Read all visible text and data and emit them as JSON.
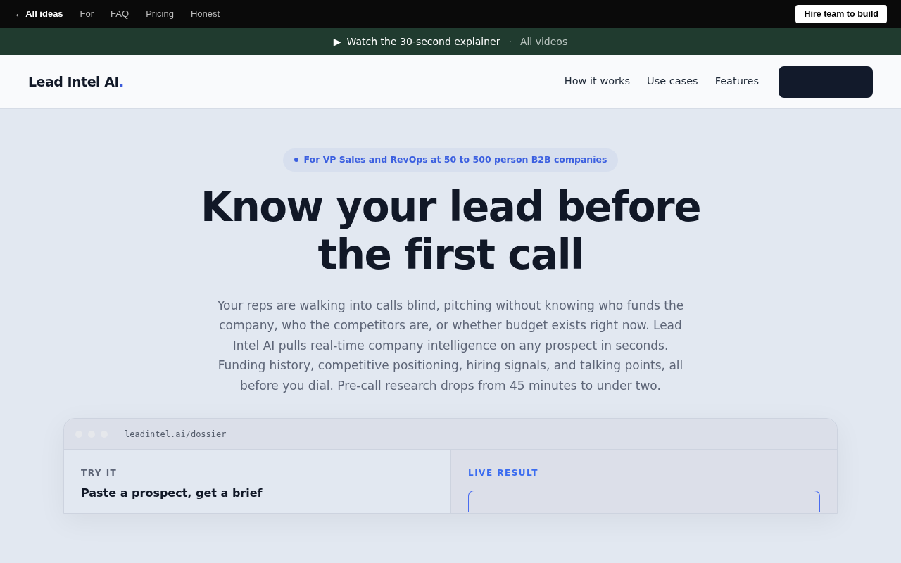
{
  "topbar": {
    "back_link": "← All ideas",
    "links": [
      "For",
      "FAQ",
      "Pricing",
      "Honest"
    ],
    "button": "Hire team to build"
  },
  "video_banner": {
    "icon": "▶",
    "link": "Watch the 30-second explainer",
    "separator": "·",
    "secondary": "All videos"
  },
  "header": {
    "logo": "Lead Intel AI",
    "logo_dot": ".",
    "nav": [
      "How it works",
      "Use cases",
      "Features"
    ]
  },
  "hero": {
    "pill": "For VP Sales and RevOps at 50 to 500 person B2B companies",
    "title_lines": [
      "Know your lead before",
      "the first call"
    ],
    "description": "Your reps are walking into calls blind, pitching without knowing who funds the company, who the competitors are, or whether budget exists right now. Lead Intel AI pulls real-time company intelligence on any prospect in seconds. Funding history, competitive positioning, hiring signals, and talking points, all before you dial. Pre-call research drops from 45 minutes to under two."
  },
  "demo": {
    "url": "leadintel.ai/dossier",
    "left": {
      "eyebrow": "TRY IT",
      "heading": "Paste a prospect, get a brief"
    },
    "right": {
      "eyebrow": "LIVE RESULT"
    }
  }
}
